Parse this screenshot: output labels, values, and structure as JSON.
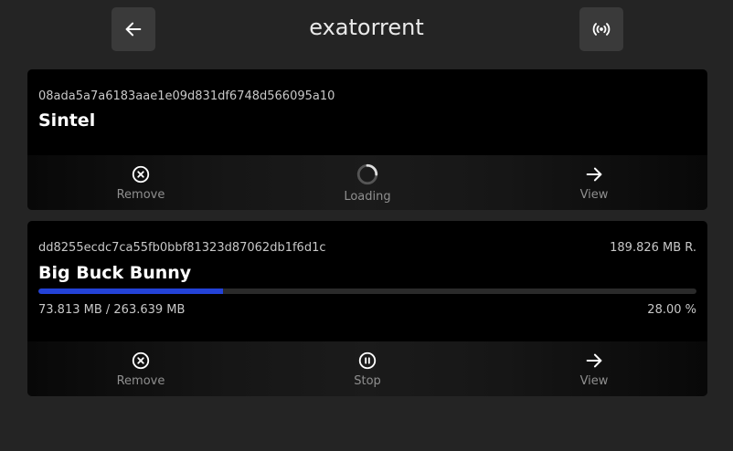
{
  "app": {
    "title": "exatorrent"
  },
  "header": {
    "back_icon": "arrow-left-icon",
    "broadcast_icon": "broadcast-icon"
  },
  "colors": {
    "progress": "#2342d8",
    "background": "#242424",
    "card": "#000000"
  },
  "torrents": [
    {
      "hash": "08ada5a7a6183aae1e09d831df6748d566095a10",
      "name": "Sintel",
      "actions": [
        {
          "label": "Remove",
          "icon": "remove-circle-icon"
        },
        {
          "label": "Loading",
          "icon": "loading-spinner-icon"
        },
        {
          "label": "View",
          "icon": "arrow-right-icon"
        }
      ]
    },
    {
      "hash": "dd8255ecdc7ca55fb0bbf81323d87062db1f6d1c",
      "remaining": "189.826 MB R.",
      "name": "Big Buck Bunny",
      "progress_text": "73.813 MB / 263.639 MB",
      "percent_text": "28.00 %",
      "progress": 0.28,
      "actions": [
        {
          "label": "Remove",
          "icon": "remove-circle-icon"
        },
        {
          "label": "Stop",
          "icon": "pause-circle-icon"
        },
        {
          "label": "View",
          "icon": "arrow-right-icon"
        }
      ]
    }
  ]
}
